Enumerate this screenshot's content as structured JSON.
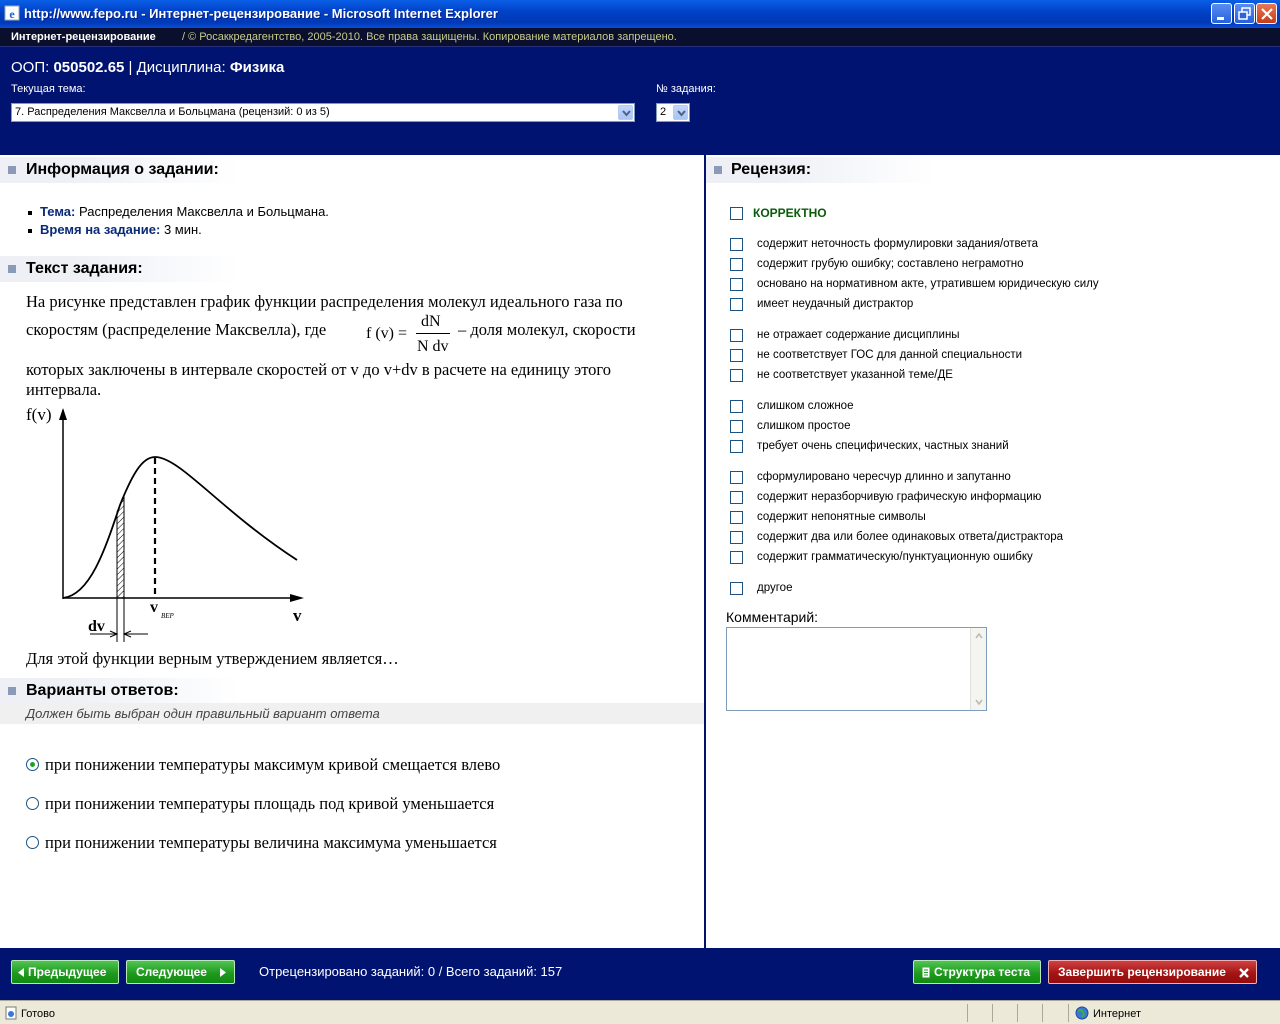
{
  "window": {
    "title": "http://www.fepo.ru - Интернет-рецензирование - Microsoft Internet Explorer"
  },
  "site": {
    "brand": "Интернет-рецензирование",
    "copyright": "/ © Росаккредагентство, 2005-2010. Все права защищены. Копирование материалов запрещено.",
    "oop_label": "ООП:",
    "oop_value": "050502.65",
    "discipline_label": "| Дисциплина:",
    "discipline_value": "Физика",
    "topic_label": "Текущая тема:",
    "topic_selected": "7. Распределения Максвелла и Больцмана  (рецензий: 0 из 5)",
    "task_no_label": "№ задания:",
    "task_no_selected": "2"
  },
  "info": {
    "header": "Информация о задании:",
    "topic_key": "Тема:",
    "topic_val": "Распределения Максвелла и Больцмана.",
    "time_key": "Время на задание:",
    "time_val": "3 мин."
  },
  "task": {
    "header": "Текст задания:",
    "line1": "На рисунке представлен график функции распределения молекул идеального газа по",
    "line2a": "скоростям (распределение Максвелла), где",
    "formula_lhs": "f (v) =",
    "formula_num": "dN",
    "formula_den": "N dv",
    "line2b": "– доля молекул, скорости",
    "line3": "которых заключены в интервале скоростей от v до v+dv в расчете на единицу этого",
    "line4": "интервала.",
    "graph_y_label": "f(v)",
    "graph_x_label": "v",
    "graph_vmax_label": "v",
    "graph_vmax_sub": "ВЕР",
    "graph_dv_label": "dv",
    "question": "Для этой функции верным утверждением является…"
  },
  "answers": {
    "header": "Варианты ответов:",
    "hint": "Должен быть выбран один правильный вариант ответа",
    "options": [
      {
        "text": "при понижении температуры максимум кривой смещается влево",
        "selected": true
      },
      {
        "text": "при понижении температуры площадь под кривой уменьшается",
        "selected": false
      },
      {
        "text": "при понижении температуры величина максимума уменьшается",
        "selected": false
      }
    ]
  },
  "review": {
    "header": "Рецензия:",
    "correct_label": "КОРРЕКТНО",
    "items": [
      "содержит неточность формулировки задания/ответа",
      "содержит грубую ошибку; составлено неграмотно",
      "основано на нормативном акте, утратившем юридическую силу",
      "имеет неудачный дистрактор",
      "не отражает содержание дисциплины",
      "не соответствует ГОС для данной специальности",
      "не соответствует указанной теме/ДЕ",
      "слишком сложное",
      "слишком простое",
      "требует очень специфических, частных знаний",
      "сформулировано чересчур длинно и запутанно",
      "содержит неразборчивую графическую информацию",
      "содержит непонятные символы",
      "содержит два или более одинаковых ответа/дистрактора",
      "содержит грамматическую/пунктуационную ошибку",
      "другое"
    ],
    "comment_label": "Комментарий:",
    "comment_value": ""
  },
  "footer": {
    "prev": "Предыдущее",
    "next": "Следующее",
    "reviewed_text": "Отрецензировано заданий: 0 / Всего заданий:  157",
    "structure": "Структура теста",
    "finish": "Завершить рецензирование"
  },
  "status": {
    "ready": "Готово",
    "zone": "Интернет"
  }
}
